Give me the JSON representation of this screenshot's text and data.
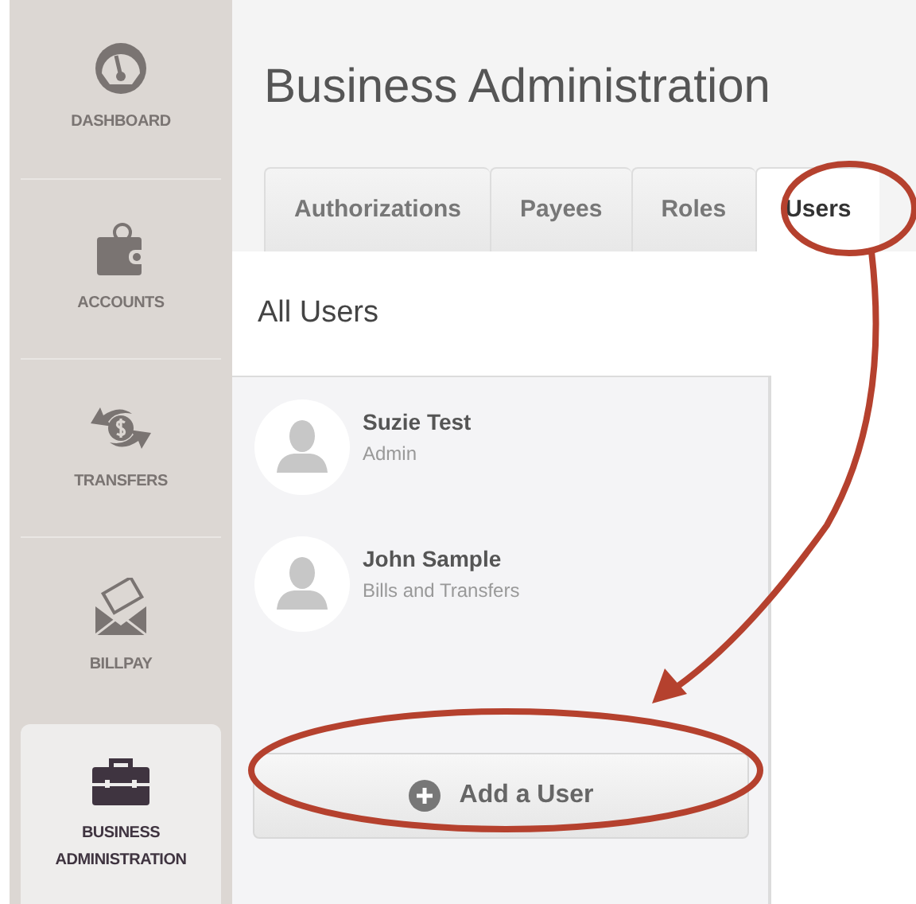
{
  "sidebar": {
    "items": [
      {
        "label": "DASHBOARD",
        "kind": "gauge",
        "selected": false
      },
      {
        "label": "ACCOUNTS",
        "kind": "wallet",
        "selected": false
      },
      {
        "label": "TRANSFERS",
        "kind": "transfer",
        "selected": false
      },
      {
        "label": "BILLPAY",
        "kind": "envelope",
        "selected": false
      },
      {
        "label": "BUSINESS ADMINISTRATION",
        "kind": "briefcase",
        "selected": true
      }
    ]
  },
  "page": {
    "title": "Business Administration"
  },
  "tabs": [
    {
      "label": "Authorizations",
      "selected": false
    },
    {
      "label": "Payees",
      "selected": false
    },
    {
      "label": "Roles",
      "selected": false
    },
    {
      "label": "Users",
      "selected": true
    }
  ],
  "section": {
    "title": "All Users"
  },
  "users": [
    {
      "name": "Suzie Test",
      "role": "Admin"
    },
    {
      "name": "John Sample",
      "role": "Bills and Transfers"
    }
  ],
  "add_button": {
    "label": "Add a User"
  }
}
